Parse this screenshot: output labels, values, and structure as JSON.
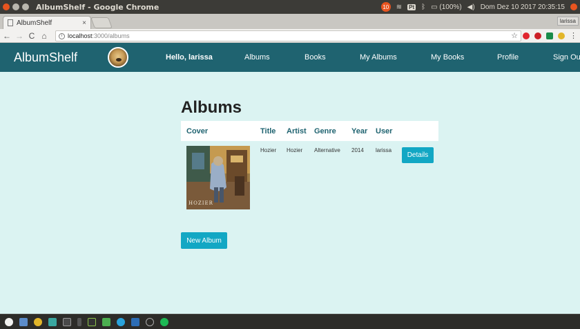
{
  "os": {
    "window_title": "AlbumShelf - Google Chrome",
    "tray": {
      "badge": "10",
      "keyboard": "Pt",
      "battery": "(100%)",
      "clock": "Dom Dez 10 2017 20:35:15"
    }
  },
  "browser": {
    "tab_title": "AlbumShelf",
    "tab_close": "×",
    "profile_label": "larissa",
    "url_host": "localhost",
    "url_path": ":3000/albums",
    "info_glyph": "i",
    "star_glyph": "☆"
  },
  "navbar": {
    "brand": "AlbumShelf",
    "greeting": "Hello, larissa",
    "links": [
      "Albums",
      "Books",
      "My Albums",
      "My Books",
      "Profile",
      "Sign Out"
    ]
  },
  "page": {
    "title": "Albums",
    "columns": [
      "Cover",
      "Title",
      "Artist",
      "Genre",
      "Year",
      "User"
    ],
    "rows": [
      {
        "title": "Hozier",
        "artist": "Hozier",
        "genre": "Alternative",
        "year": "2014",
        "user": "larissa",
        "details_label": "Details",
        "cover_text": "HOZIER"
      }
    ],
    "new_album_label": "New Album"
  },
  "colors": {
    "navbar": "#1f6370",
    "page_bg": "#dbf3f2",
    "button": "#12a7c4"
  }
}
